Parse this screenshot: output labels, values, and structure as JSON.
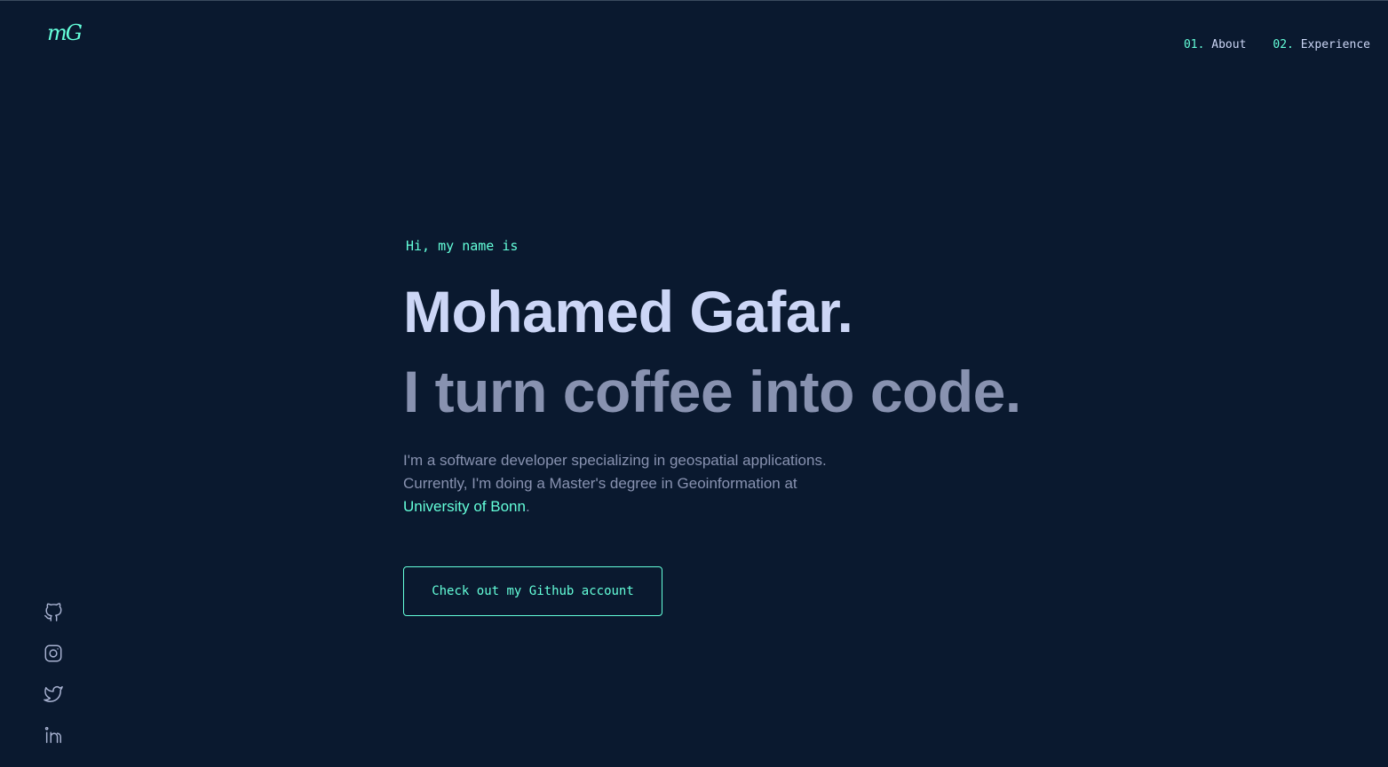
{
  "header": {
    "logo": "mG",
    "nav": [
      {
        "number": "01.",
        "label": "About"
      },
      {
        "number": "02.",
        "label": "Experience"
      }
    ]
  },
  "hero": {
    "greeting": "Hi, my name is",
    "name": "Mohamed Gafar.",
    "tagline": "I turn coffee into code.",
    "bio_line1": "I'm a software developer specializing in geospatial applications.",
    "bio_line2": "Currently, I'm doing a Master's degree in Geoinformation at",
    "bio_link": "University of Bonn",
    "bio_end": ".",
    "cta_label": "Check out my Github account"
  },
  "socials": [
    {
      "icon": "github-icon"
    },
    {
      "icon": "instagram-icon"
    },
    {
      "icon": "twitter-icon"
    },
    {
      "icon": "linkedin-icon"
    }
  ],
  "colors": {
    "background": "#0a192f",
    "accent": "#64ffda",
    "heading": "#ccd6f6",
    "text": "#8892b0"
  }
}
